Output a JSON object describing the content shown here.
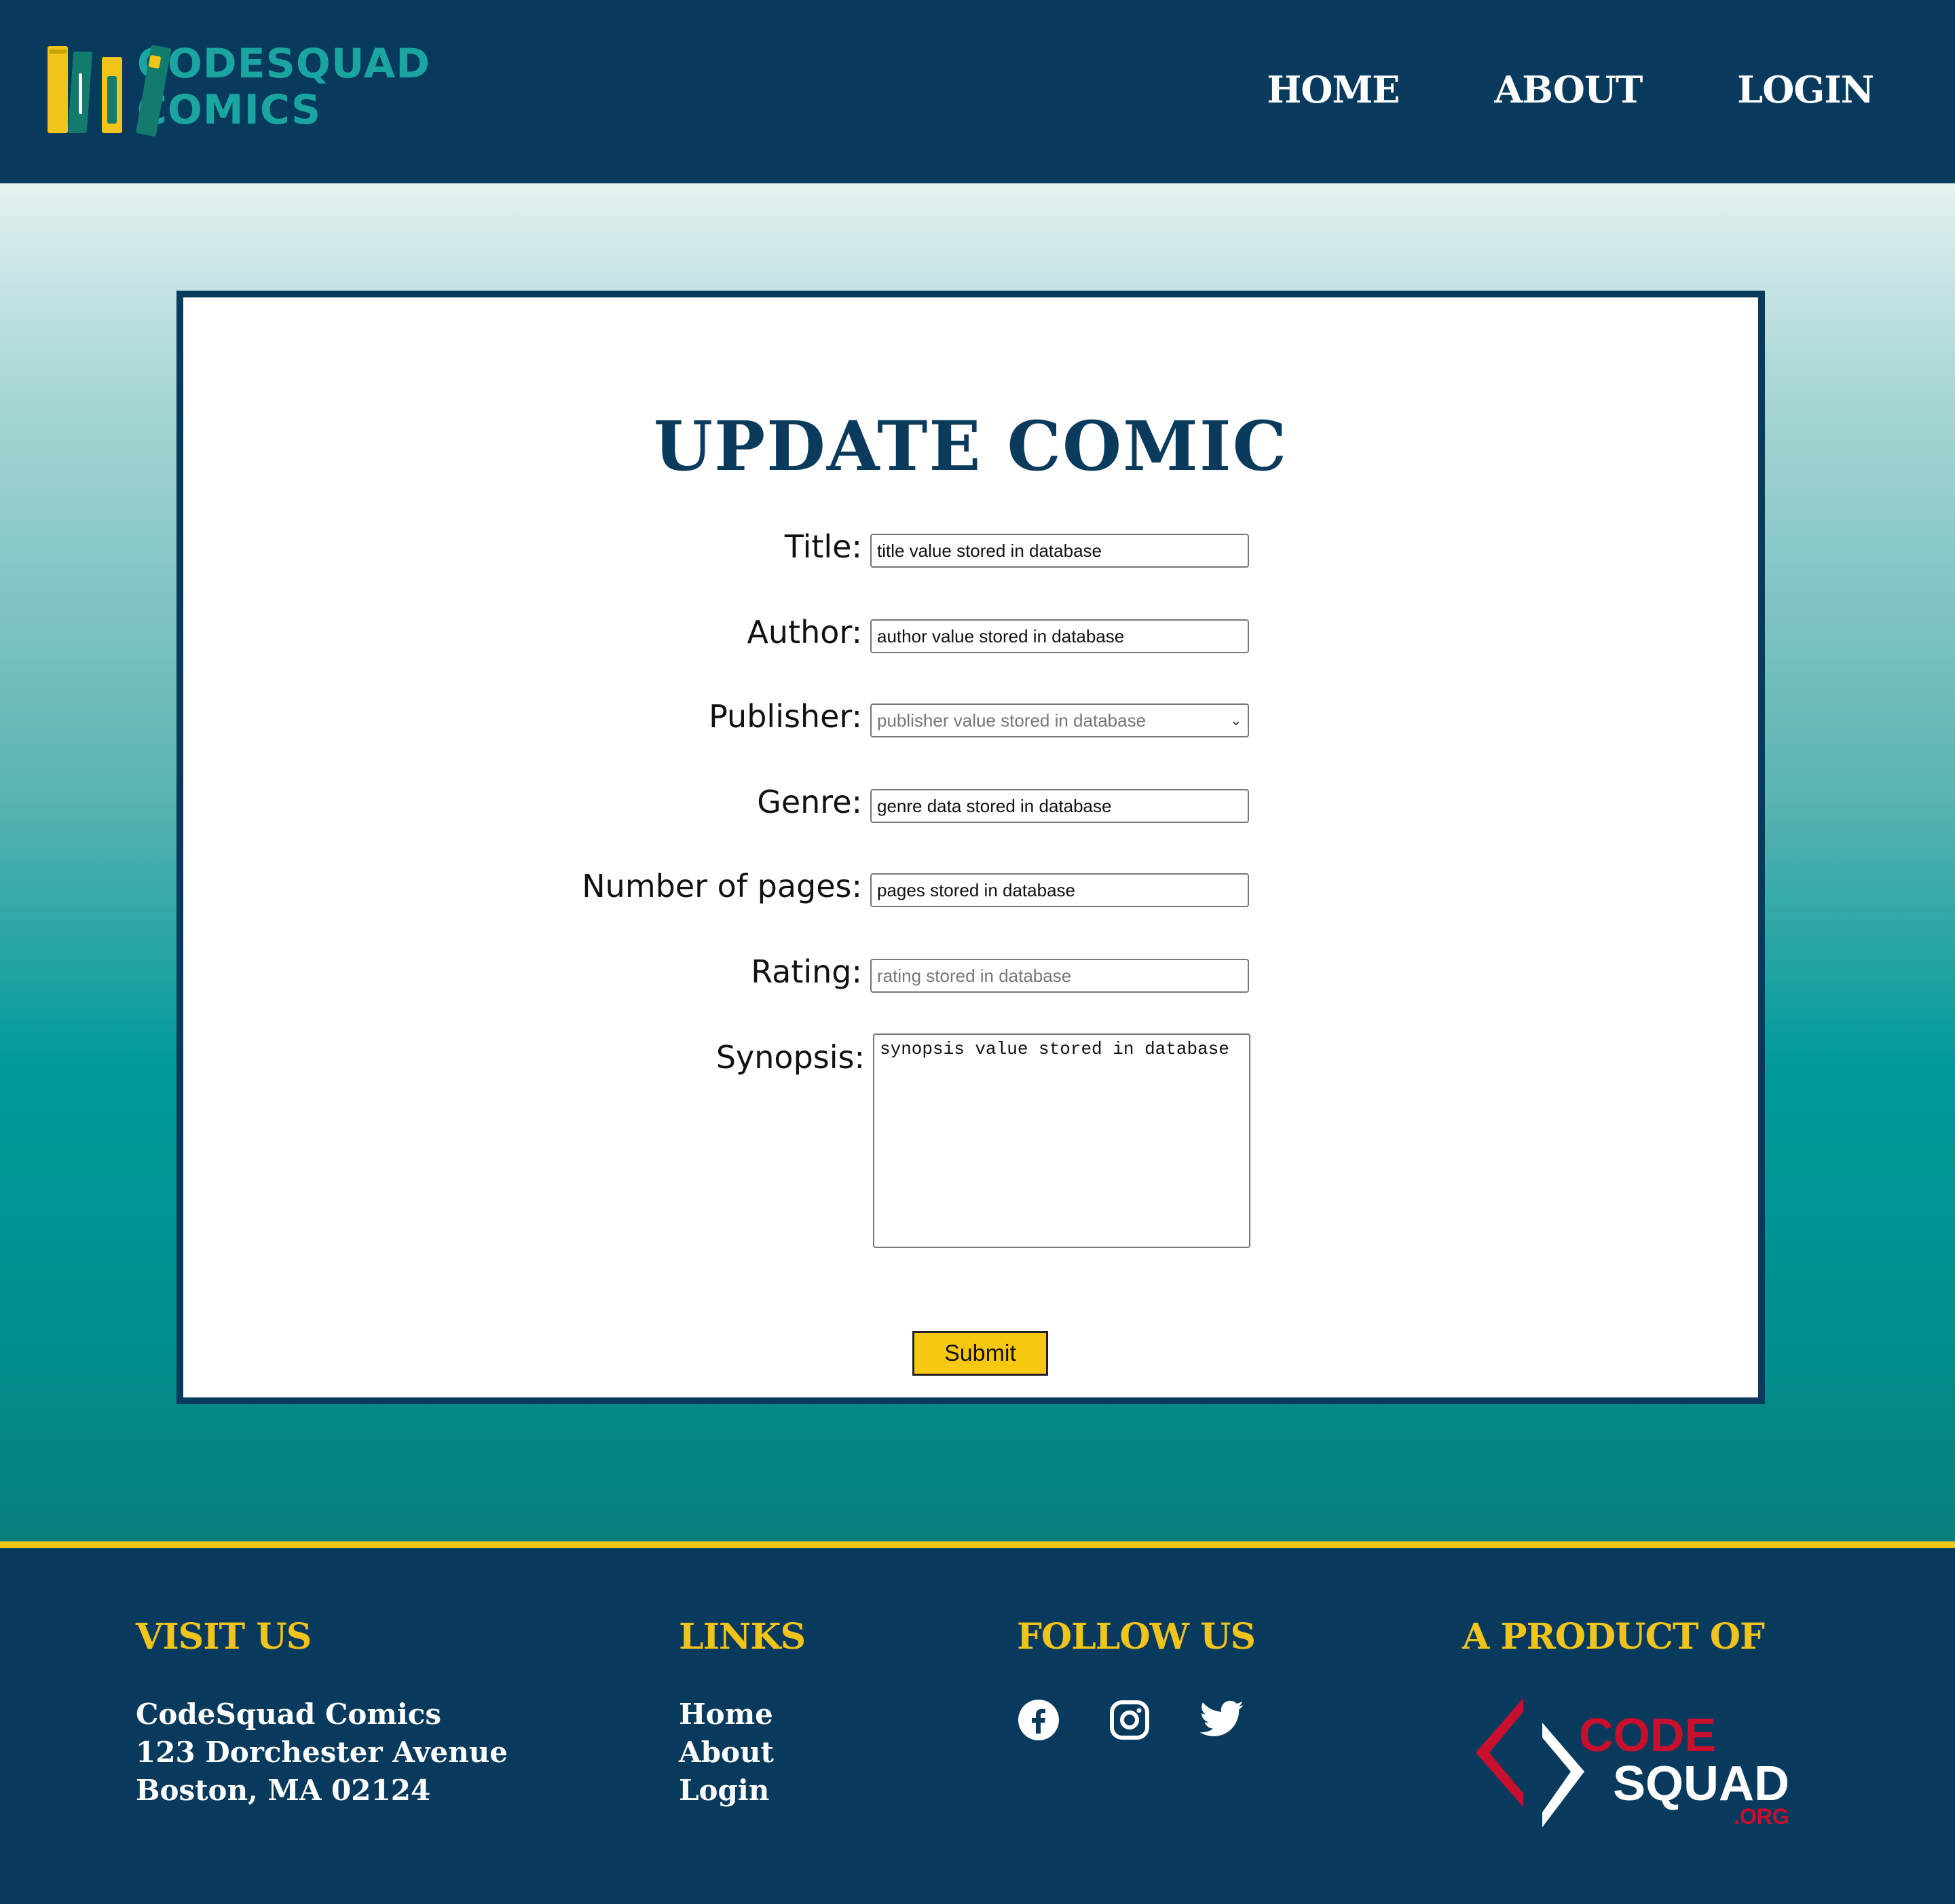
{
  "brand": {
    "line1": "CODESQUAD",
    "line2": "COMICS"
  },
  "nav": {
    "home": "HOME",
    "about": "ABOUT",
    "login": "LOGIN"
  },
  "form": {
    "title": "UPDATE COMIC",
    "fields": {
      "title": {
        "label": "Title:",
        "value": "title value stored in database"
      },
      "author": {
        "label": "Author:",
        "value": "author value stored in database"
      },
      "publisher": {
        "label": "Publisher:",
        "value": "publisher value stored in database"
      },
      "genre": {
        "label": "Genre:",
        "value": "genre data stored in database"
      },
      "pages": {
        "label": "Number of pages:",
        "value": "pages stored in database"
      },
      "rating": {
        "label": "Rating:",
        "placeholder": "rating stored in database"
      },
      "synopsis": {
        "label": "Synopsis:",
        "value": "synopsis value stored in database"
      }
    },
    "submit": "Submit"
  },
  "footer": {
    "visit": {
      "heading": "VISIT US",
      "name": "CodeSquad Comics",
      "street": "123 Dorchester Avenue",
      "city": "Boston, MA 02124"
    },
    "links": {
      "heading": "LINKS",
      "home": "Home",
      "about": "About",
      "login": "Login"
    },
    "follow": {
      "heading": "FOLLOW US",
      "icons": [
        "facebook-icon",
        "instagram-icon",
        "twitter-icon"
      ]
    },
    "product": {
      "heading": "A PRODUCT OF",
      "logo_code": "CODE",
      "logo_squad": "SQUAD",
      "logo_org": ".ORG"
    }
  },
  "colors": {
    "navy": "#083a5e",
    "teal": "#00999a",
    "yellow": "#f0c419",
    "brand_teal": "#1aa5a0",
    "red": "#c8102e"
  }
}
